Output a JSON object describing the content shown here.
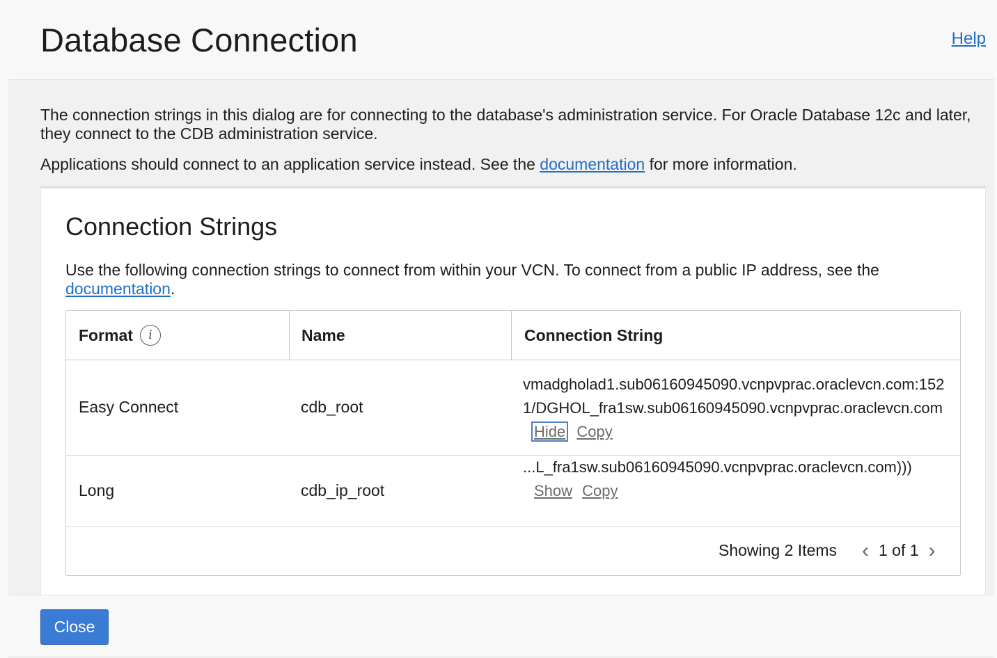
{
  "dialog": {
    "title": "Database Connection",
    "help_link": "Help"
  },
  "intro": {
    "paragraph1": "The connection strings in this dialog are for connecting to the database's administration service. For Oracle Database 12c and later, they connect to the CDB administration service.",
    "paragraph2_prefix": "Applications should connect to an application service instead. See the",
    "paragraph2_link": "documentation",
    "paragraph2_suffix": "for more information."
  },
  "connection_strings": {
    "title": "Connection Strings",
    "desc_prefix": "Use the following connection strings to connect from within your VCN. To connect from a public IP address, see the",
    "desc_link": "documentation",
    "desc_suffix": ".",
    "table": {
      "headers": {
        "format": "Format",
        "name": "Name",
        "connection_string": "Connection String"
      },
      "info_icon": "info-icon",
      "rows": [
        {
          "format": "Easy Connect",
          "name": "cdb_root",
          "connection_string": "vmadgholad1.sub06160945090.vcnpvprac.oraclevcn.com:1521/DGHOL_fra1sw.sub06160945090.vcnpvprac.oraclevcn.com",
          "toggle_label": "Hide",
          "copy_label": "Copy"
        },
        {
          "format": "Long",
          "name": "cdb_ip_root",
          "connection_string": "...L_fra1sw.sub06160945090.vcnpvprac.oraclevcn.com)))",
          "toggle_label": "Show",
          "copy_label": "Copy"
        }
      ],
      "footer": {
        "showing": "Showing 2 Items",
        "page": "1 of 1",
        "prev_icon": "chevron-left-icon",
        "next_icon": "chevron-right-icon"
      }
    }
  },
  "footer": {
    "close_label": "Close"
  },
  "colors": {
    "accent": "#3a7bd5",
    "link": "#1f6fc5"
  }
}
